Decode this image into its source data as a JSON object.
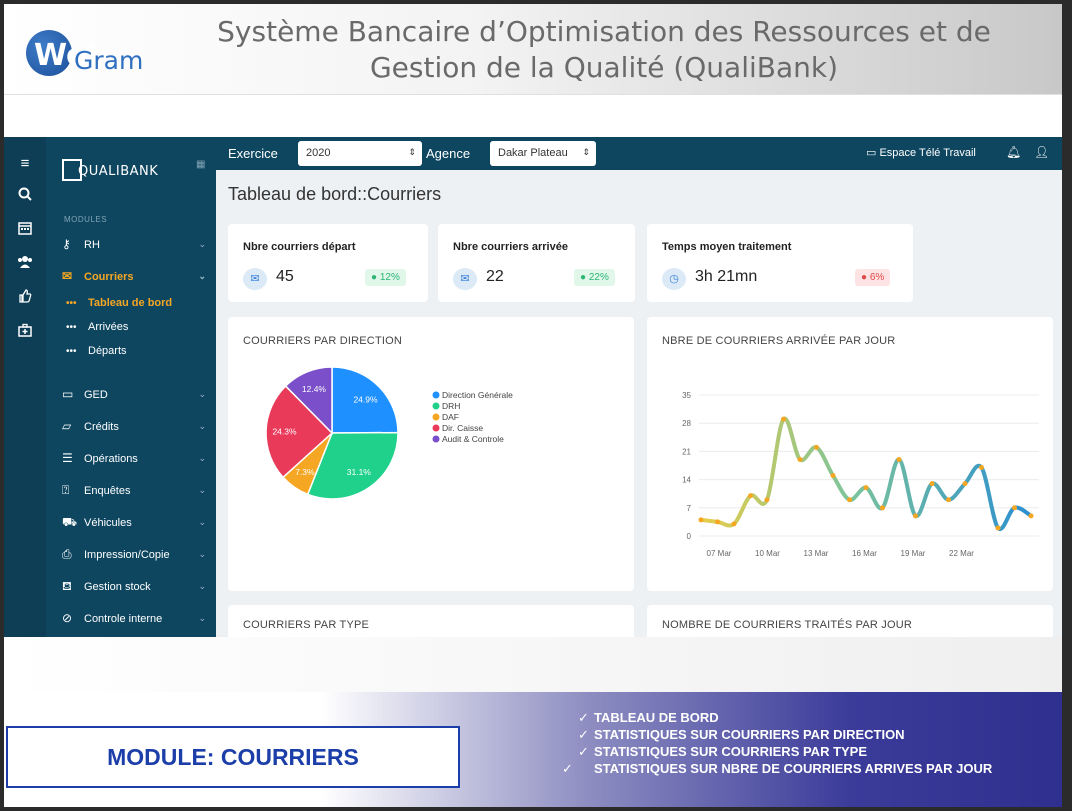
{
  "header": {
    "logo_web": "Web",
    "logo_gram": "Gram",
    "title_line1": "Système Bancaire d’Optimisation des Ressources et de",
    "title_line2": "Gestion de la Qualité (QualiBank)"
  },
  "sidebar": {
    "logo_text": "QUALIBANK",
    "section_label": "MODULES",
    "items": [
      {
        "label": "RH",
        "icon": "key-icon"
      },
      {
        "label": "Courriers",
        "icon": "envelope-icon"
      },
      {
        "label": "GED",
        "icon": "folder-icon"
      },
      {
        "label": "Crédits",
        "icon": "folder-open-icon"
      },
      {
        "label": "Opérations",
        "icon": "list-icon"
      },
      {
        "label": "Enquêtes",
        "icon": "question-icon"
      },
      {
        "label": "Véhicules",
        "icon": "car-icon"
      },
      {
        "label": "Impression/Copie",
        "icon": "printer-icon"
      },
      {
        "label": "Gestion stock",
        "icon": "cart-icon"
      },
      {
        "label": "Controle interne",
        "icon": "check-circle-icon"
      }
    ],
    "subitems": [
      {
        "label": "Tableau de bord"
      },
      {
        "label": "Arrivées"
      },
      {
        "label": "Départs"
      }
    ]
  },
  "toolbar": {
    "exercice_label": "Exercice",
    "exercice_value": "2020",
    "agence_label": "Agence",
    "agence_value": "Dakar Plateau",
    "espace_label": "Espace Télé Travail"
  },
  "page": {
    "title": "Tableau de bord::Courriers"
  },
  "stats": [
    {
      "title": "Nbre courriers départ",
      "value": "45",
      "badge": "12%",
      "trend": "up"
    },
    {
      "title": "Nbre courriers arrivée",
      "value": "22",
      "badge": "22%",
      "trend": "up"
    },
    {
      "title": "Temps moyen traitement",
      "value": "3h 21mn",
      "badge": "6%",
      "trend": "down"
    }
  ],
  "cards": {
    "pie_title": "COURRIERS PAR DIRECTION",
    "line_title": "NBRE DE COURRIERS ARRIVÉE PAR JOUR",
    "type_title": "COURRIERS PAR TYPE",
    "traites_title": "NOMBRE DE COURRIERS TRAITÉS PAR JOUR"
  },
  "banner": {
    "module": "MODULE: COURRIERS",
    "bullets": [
      "TABLEAU DE BORD",
      "STATISTIQUES SUR COURRIERS PAR DIRECTION",
      "STATISTIQUES SUR COURRIERS PAR TYPE",
      "STATISTIQUES SUR NBRE DE COURRIERS ARRIVES PAR JOUR"
    ]
  },
  "colors": {
    "sidebar": "#0e4660",
    "accent": "#f5a623",
    "banner_blue": "#1c3ea8"
  },
  "chart_data": [
    {
      "type": "pie",
      "title": "COURRIERS PAR DIRECTION",
      "labels": [
        "Direction Générale",
        "DRH",
        "DAF",
        "Dir. Caisse",
        "Audit & Controle"
      ],
      "values": [
        24.9,
        31.1,
        7.3,
        24.3,
        12.4
      ],
      "value_labels": [
        "24.9%",
        "31.1%",
        "7.3%",
        "24.3%",
        "12.4%"
      ],
      "colors": [
        "#1e90ff",
        "#1fd18a",
        "#f5a623",
        "#ea3a5a",
        "#7a4fc9"
      ],
      "legend": "right"
    },
    {
      "type": "line",
      "title": "NBRE DE COURRIERS ARRIVÉE PAR JOUR",
      "x_ticks": [
        "07 Mar",
        "10 Mar",
        "13 Mar",
        "16 Mar",
        "19 Mar",
        "22 Mar"
      ],
      "y_ticks": [
        "0",
        "7",
        "14",
        "21",
        "28",
        "35"
      ],
      "ylim": [
        0,
        35
      ],
      "x": [
        0,
        1,
        2,
        3,
        4,
        5,
        6,
        7,
        8,
        9,
        10,
        11,
        12,
        13,
        14,
        15,
        16,
        17,
        18,
        19,
        20,
        21,
        22,
        23,
        24,
        25,
        26
      ],
      "values": [
        4,
        3.5,
        3,
        10,
        9,
        29,
        19,
        22,
        15,
        9,
        12,
        7,
        19,
        5,
        13,
        9,
        13,
        17,
        2,
        7,
        5
      ],
      "grid": true
    }
  ]
}
